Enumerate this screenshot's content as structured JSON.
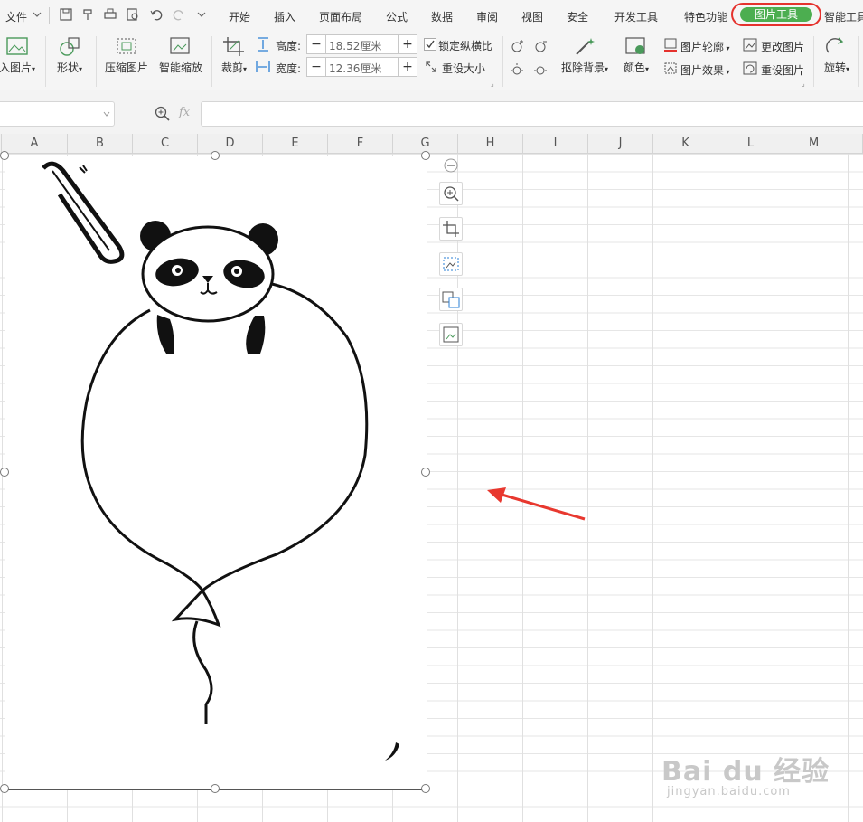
{
  "menu": {
    "file": "文件",
    "tabs": [
      "开始",
      "插入",
      "页面布局",
      "公式",
      "数据",
      "审阅",
      "视图",
      "安全",
      "开发工具",
      "特色功能",
      "图片工具",
      "智能工具"
    ],
    "active_tab": "图片工具",
    "active_color": "#4cae50",
    "highlight_ring_color": "#e5322d"
  },
  "ribbon": {
    "insert_picture": "入图片",
    "shape": "形状",
    "compress": "压缩图片",
    "smart_zoom": "智能缩放",
    "crop": "裁剪",
    "height_label": "高度:",
    "height_value": "18.52厘米",
    "width_label": "宽度:",
    "width_value": "12.36厘米",
    "lock_ratio": "锁定纵横比",
    "reset_size": "重设大小",
    "remove_bg": "抠除背景",
    "color": "颜色",
    "outline": "图片轮廓",
    "effect": "图片效果",
    "change_picture": "更改图片",
    "reset_picture": "重设图片",
    "rotate": "旋转"
  },
  "formula_bar": {
    "fx": "fx",
    "value": ""
  },
  "columns": [
    "A",
    "B",
    "C",
    "D",
    "E",
    "F",
    "G",
    "H",
    "I",
    "J",
    "K",
    "L",
    "M"
  ],
  "side_toolbar": [
    "zoom-in-icon",
    "crop-icon",
    "select-icon",
    "image-convert-icon",
    "image-replace-icon"
  ],
  "annotation_arrow_color": "#e8382f",
  "watermark": {
    "main": "Bai du 经验",
    "sub": "jingyan.baidu.com"
  }
}
